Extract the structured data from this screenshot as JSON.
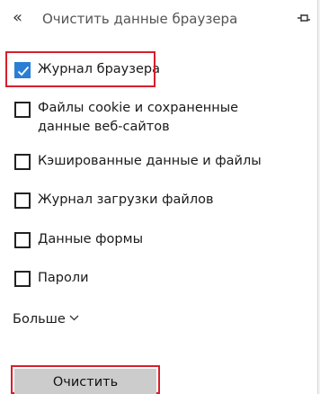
{
  "header": {
    "back_glyph": "«",
    "title": "Очистить данные браузера",
    "pin_icon": "pin-icon"
  },
  "options": [
    {
      "label": "Журнал браузера",
      "checked": true
    },
    {
      "label": "Файлы cookie и сохраненные данные веб-сайтов",
      "checked": false
    },
    {
      "label": "Кэшированные данные и файлы",
      "checked": false
    },
    {
      "label": "Журнал загрузки файлов",
      "checked": false
    },
    {
      "label": "Данные формы",
      "checked": false
    },
    {
      "label": "Пароли",
      "checked": false
    }
  ],
  "more": {
    "label": "Больше"
  },
  "clear_button": {
    "label": "Очистить"
  },
  "colors": {
    "accent": "#2a7fd4",
    "highlight": "#d61f2c",
    "button_bg": "#cccccc"
  }
}
